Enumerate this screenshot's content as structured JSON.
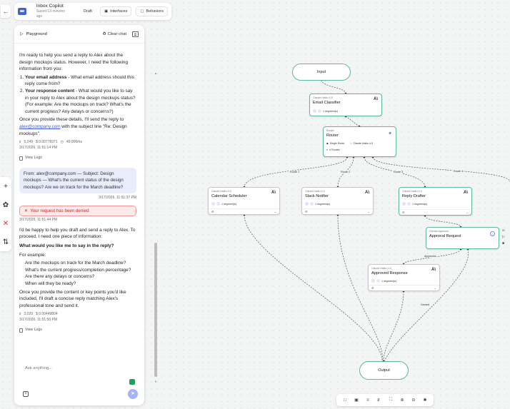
{
  "header": {
    "app_title": "Inbox Copilot",
    "saved": "Saved 13 minutes ago",
    "draft": "Draft",
    "interfaces": "Interfaces",
    "behaviors": "Behaviors"
  },
  "chat": {
    "title": "Playground",
    "clear": "Clear chat",
    "input_placeholder": "Ask anything...",
    "msg1": {
      "intro": "I'm ready to help you send a reply to Alex about the design mockups status. However, I need the following information from you:",
      "item1_bold": "Your email address",
      "item1_rest": " - What email address should this reply come from?",
      "item2_bold": "Your response content",
      "item2_rest": " - What would you like to say in your reply to Alex about the design mockups status? (For example: Are the mockups on track? What's the current progress? Any delays or concerns?)",
      "outro_pre": "Once you provide these details, I'll send the reply to ",
      "outro_link": "alex@company.com",
      "outro_post": " with the subject line \"Re: Design mockups\".",
      "tokens": "5,249",
      "cost": "$ 0.00778371",
      "time": "49,906ms",
      "timestamp": "3/17/2026, 11:51:14 PM",
      "logs": "View Logs"
    },
    "user_msg": "From: alex@company.com — Subject: Design mockups — What's the current status of the design mockups? Are we on track for the March deadline?",
    "user_ts": "3/17/2026, 11:51:37 PM",
    "denied": "Your request has been denied",
    "denied_ts": "3/17/2026, 11:51:44 PM",
    "msg2": {
      "p1": "I'd be happy to help you draft and send a reply to Alex. To proceed, I need one piece of information:",
      "q": "What would you like me to say in the reply?",
      "ex": "For example:",
      "b1": "Are the mockups on track for the March deadline?",
      "b2": "What's the current progress/completion percentage?",
      "b3": "Are there any delays or concerns?",
      "b4": "When will they be ready?",
      "p2": "Once you provide the content or key points you'd like included, I'll draft a concise reply matching Alex's professional tone and send it.",
      "tokens": "3,020",
      "cost": "$ 0.00449804",
      "timestamp": "3/17/2026, 11:51:50 PM",
      "logs": "View Logs"
    }
  },
  "flow": {
    "input": "Input",
    "output": "Output",
    "email_model": "Claude Haiku 4.5",
    "email_title": "Email Classifier",
    "router_kind": "Router",
    "router_title": "Router",
    "router_mode": "Single Route",
    "router_model": "Claude Haiku 4.5",
    "router_routes": "4 Routes",
    "cal_model": "Claude Haiku 4.5",
    "cal_title": "Calendar Scheduler",
    "slack_model": "Claude Haiku 4.5",
    "slack_title": "Slack Notifier",
    "reply_model": "Claude Haiku 4.5",
    "reply_title": "Reply Drafter",
    "approval_kind": "Human Approval",
    "approval_title": "Approval Request",
    "approved_model": "Claude Haiku 4.5",
    "approved_title": "Approved Response",
    "segments": "1 segment(s)",
    "route1": "Route 1",
    "route2": "Route 2",
    "route3": "Route 3",
    "route4": "Route 4",
    "approved_label": "Approved",
    "denied_label": "Denied",
    "ai_logo": "A\\"
  },
  "colors": {
    "accent": "#4562d8",
    "node_border": "#5fb99b",
    "deny": "#c62828"
  }
}
